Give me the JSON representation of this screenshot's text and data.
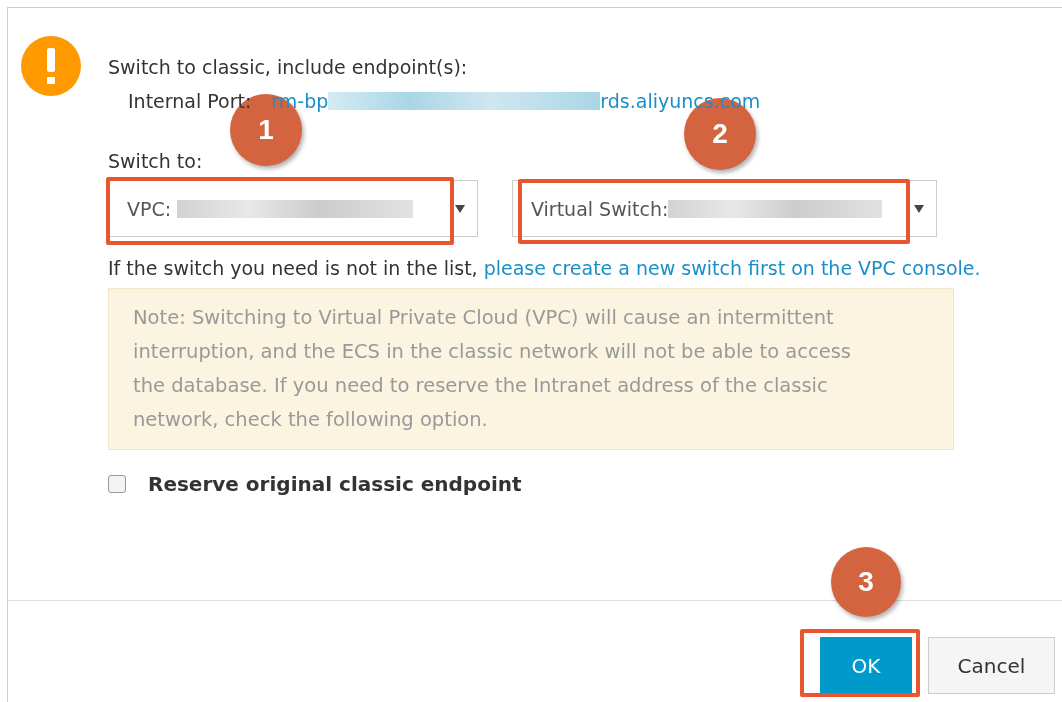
{
  "dialog": {
    "title": "Switch to classic, include endpoint(s):",
    "internal_port": {
      "label": "Internal Port:",
      "value_start": "rm-bp",
      "value_end": "rds.aliyuncs.com"
    },
    "switch_to_label": "Switch to:",
    "selects": [
      {
        "label": "VPC:",
        "step": "1"
      },
      {
        "label": "Virtual Switch:",
        "step": "2"
      }
    ],
    "help": {
      "text": "If the switch you need is not in the list,",
      "link": "please create a new switch first on the VPC console."
    },
    "note": "Note: Switching to Virtual Private Cloud (VPC) will cause an intermittent interruption, and the ECS in the classic network will not be able to access the database. If you need to reserve the Intranet address of the classic network, check the following option.",
    "checkbox": {
      "label": "Reserve original classic endpoint",
      "checked": false
    },
    "buttons": [
      {
        "label": "OK",
        "kind": "primary",
        "step": "3"
      },
      {
        "label": "Cancel",
        "kind": "default"
      }
    ]
  }
}
